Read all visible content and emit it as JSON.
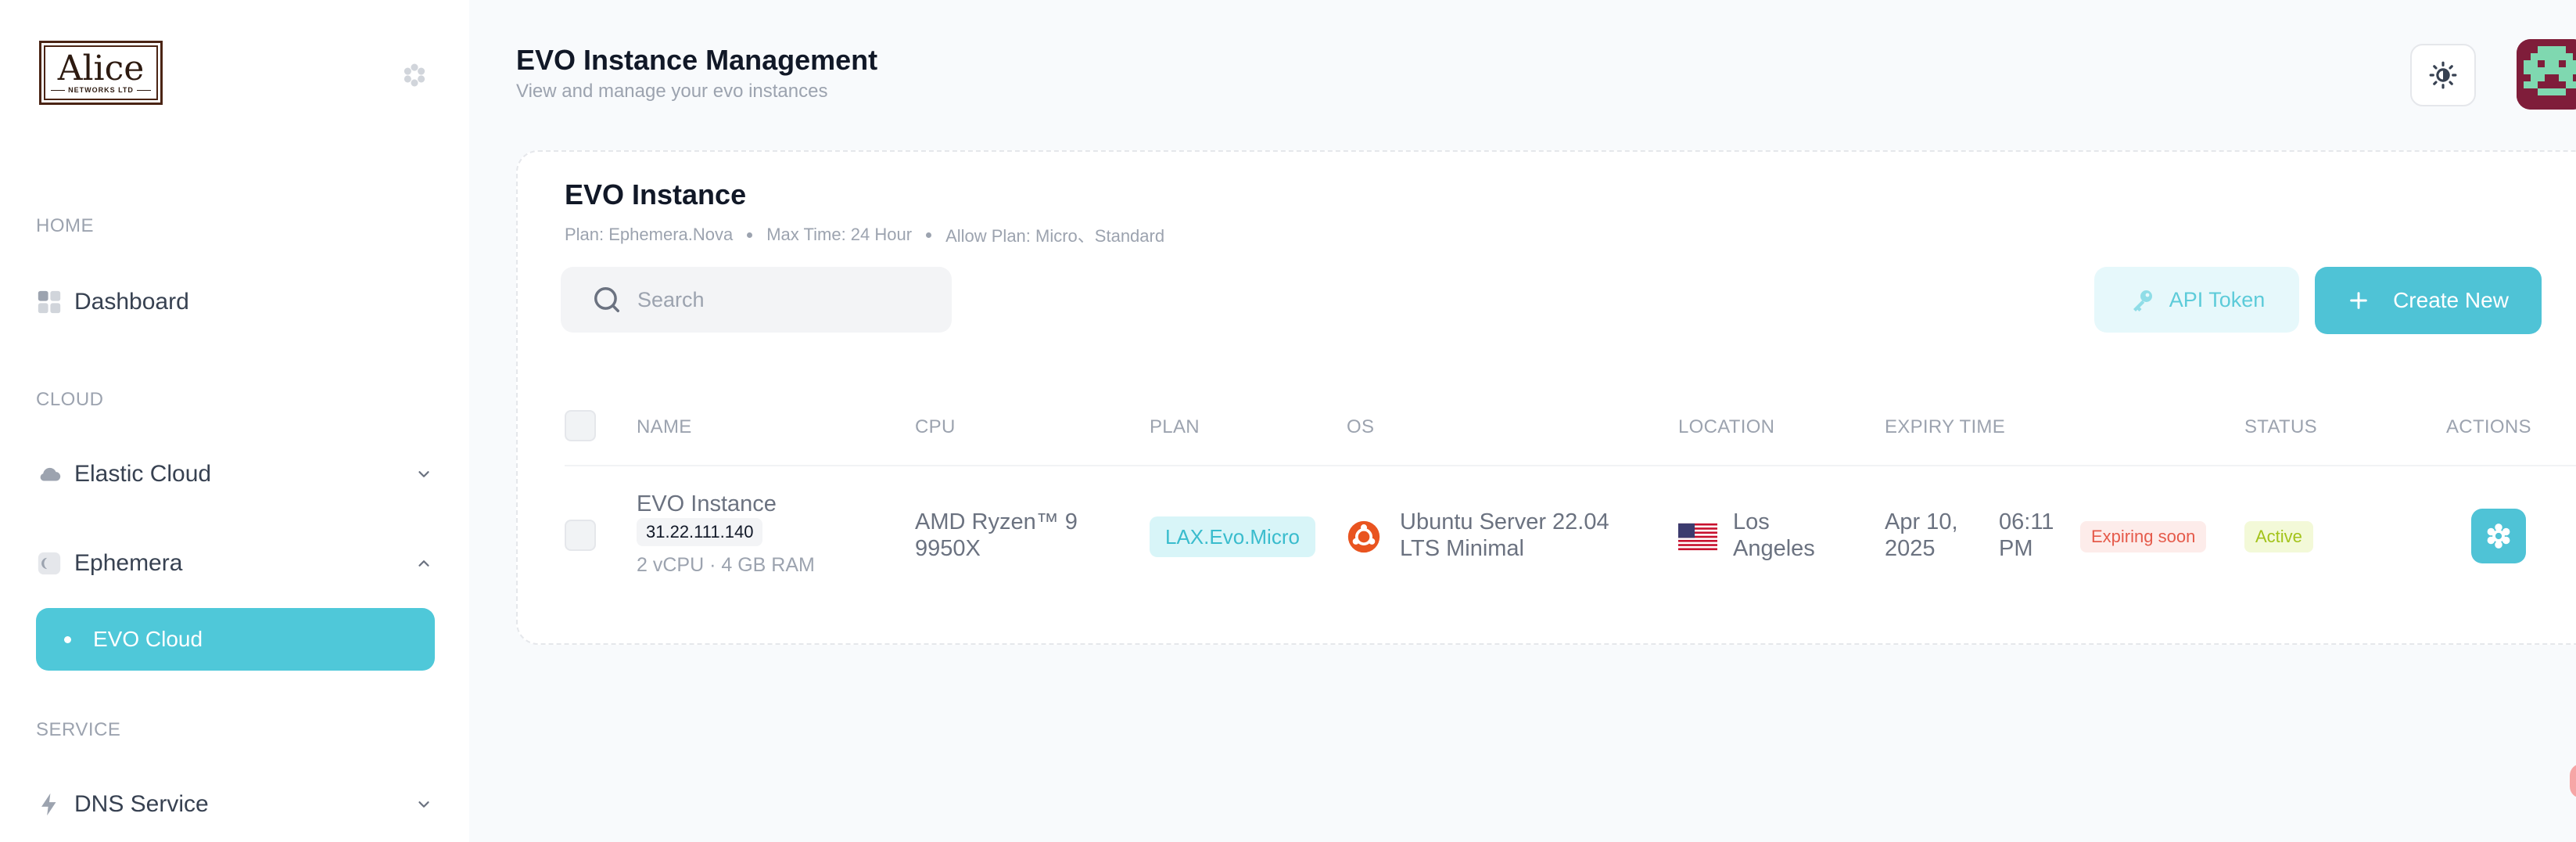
{
  "sidebar": {
    "logo_word": "Alice",
    "logo_sub": "NETWORKS LTD",
    "sections": {
      "home": "HOME",
      "cloud": "CLOUD",
      "service": "SERVICE"
    },
    "items": {
      "dashboard": "Dashboard",
      "elastic_cloud": "Elastic Cloud",
      "ephemera": "Ephemera",
      "evo_cloud": "EVO Cloud",
      "dns_service": "DNS Service"
    }
  },
  "header": {
    "title": "EVO Instance Management",
    "subtitle": "View and manage your evo instances"
  },
  "card": {
    "title": "EVO Instance",
    "meta": [
      "Plan: Ephemera.Nova",
      "Max Time: 24 Hour",
      "Allow Plan: Micro、Standard"
    ],
    "search_placeholder": "Search",
    "api_token_label": "API Token",
    "create_new_label": "Create New"
  },
  "table": {
    "columns": {
      "name": "NAME",
      "cpu": "CPU",
      "plan": "PLAN",
      "os": "OS",
      "location": "LOCATION",
      "expiry": "EXPIRY TIME",
      "status": "STATUS",
      "actions": "ACTIONS"
    },
    "rows": [
      {
        "name": "EVO Instance",
        "ip": "31.22.111.140",
        "specs": "2 vCPU · 4 GB RAM",
        "cpu_line1": "AMD Ryzen™ 9",
        "cpu_line2": "9950X",
        "plan": "LAX.Evo.Micro",
        "os_line1": "Ubuntu Server 22.04",
        "os_line2": "LTS Minimal",
        "location_line1": "Los",
        "location_line2": "Angeles",
        "expiry_date_line1": "Apr 10,",
        "expiry_date_line2": "2025",
        "expiry_time_line1": "06:11",
        "expiry_time_line2": "PM",
        "expiry_badge": "Expiring soon",
        "status": "Active"
      }
    ]
  },
  "colors": {
    "accent": "#4fc3d6",
    "accent_light": "#e6f8fb",
    "expiring": "#e55a4a",
    "active": "#a3c31a"
  },
  "icons": {
    "collapse": "gear-icon",
    "dashboard": "grid-icon",
    "elastic_cloud": "cloud-icon",
    "ephemera": "moon-icon",
    "dns": "bolt-icon",
    "theme": "sun-icon",
    "search": "search-icon",
    "api_token": "key-icon",
    "create": "plus-icon",
    "os": "ubuntu-icon",
    "location": "us-flag-icon",
    "action": "gear-icon"
  }
}
